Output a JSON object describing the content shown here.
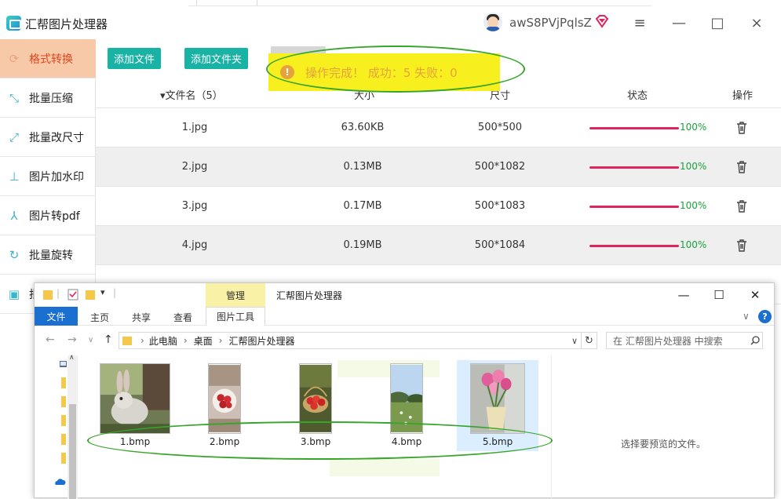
{
  "app": {
    "title": "汇帮图片处理器",
    "username": "awS8PVjPqlsZ",
    "window_buttons": [
      "≡",
      "—",
      "□",
      "×"
    ]
  },
  "sidebar": {
    "items": [
      {
        "label": "格式转换",
        "icon": "convert-icon",
        "active": true
      },
      {
        "label": "批量压缩",
        "icon": "compress-icon",
        "active": false
      },
      {
        "label": "批量改尺寸",
        "icon": "resize-icon",
        "active": false
      },
      {
        "label": "图片加水印",
        "icon": "watermark-icon",
        "active": false
      },
      {
        "label": "图片转pdf",
        "icon": "pdf-icon",
        "active": false
      },
      {
        "label": "批量旋转",
        "icon": "rotate-icon",
        "active": false
      },
      {
        "label": "批",
        "icon": "image-icon",
        "active": false
      }
    ]
  },
  "toolbar": {
    "add_file": "添加文件",
    "add_folder": "添加文件夹"
  },
  "toast": {
    "message": "操作完成！ 成功：5   失败：0",
    "color": "#e6a23c",
    "background": "#f8f01e"
  },
  "table": {
    "headers": {
      "name": "▾文件名（5）",
      "size": "大小",
      "dimensions": "尺寸",
      "status": "状态",
      "action": "操作"
    },
    "rows": [
      {
        "name": "1.jpg",
        "size": "63.60KB",
        "dimensions": "500*500",
        "progress": "100%"
      },
      {
        "name": "2.jpg",
        "size": "0.13MB",
        "dimensions": "500*1082",
        "progress": "100%"
      },
      {
        "name": "3.jpg",
        "size": "0.17MB",
        "dimensions": "500*1083",
        "progress": "100%"
      },
      {
        "name": "4.jpg",
        "size": "0.19MB",
        "dimensions": "500*1084",
        "progress": "100%"
      }
    ],
    "progress_color": "#e0245f",
    "percent_color": "#19a33b"
  },
  "explorer": {
    "manage_tab": "管理",
    "title": "汇帮图片处理器",
    "ribbon": {
      "file": "文件",
      "home": "主页",
      "share": "共享",
      "view": "查看",
      "picture_tools": "图片工具"
    },
    "breadcrumb": {
      "this_pc": "此电脑",
      "desktop": "桌面",
      "folder": "汇帮图片处理器"
    },
    "search_placeholder": "在 汇帮图片处理器 中搜索",
    "files": [
      {
        "name": "1.bmp",
        "subject": "rabbit"
      },
      {
        "name": "2.bmp",
        "subject": "strawberries-bowl"
      },
      {
        "name": "3.bmp",
        "subject": "strawberry-basket"
      },
      {
        "name": "4.bmp",
        "subject": "meadow-sky"
      },
      {
        "name": "5.bmp",
        "subject": "tulips-vase",
        "selected": true
      }
    ],
    "preview_text": "选择要预览的文件。",
    "accent": "#1a6fd1"
  },
  "annotation_color": "#37a52a"
}
